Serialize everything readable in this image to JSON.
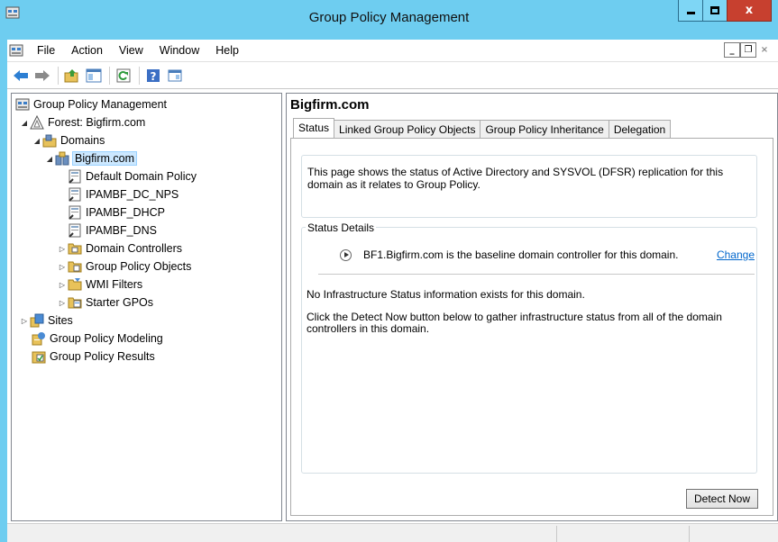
{
  "window": {
    "title": "Group Policy Management",
    "minimize_glyph": "",
    "maximize_glyph": "",
    "close_glyph": "x"
  },
  "menu": {
    "items": [
      "File",
      "Action",
      "View",
      "Window",
      "Help"
    ],
    "mdi_minimize": "_",
    "mdi_restore": "❐",
    "mdi_close": "×"
  },
  "toolbar": {
    "icons": [
      "back-arrow-icon",
      "forward-arrow-icon",
      "up-folder-icon",
      "show-hide-console-tree-icon",
      "refresh-icon",
      "help-icon",
      "properties-icon"
    ]
  },
  "tree": {
    "root": "Group Policy Management",
    "forest": "Forest: Bigfirm.com",
    "domains": "Domains",
    "domain": "Bigfirm.com",
    "gpo_links": [
      "Default Domain Policy",
      "IPAMBF_DC_NPS",
      "IPAMBF_DHCP",
      "IPAMBF_DNS"
    ],
    "containers": [
      "Domain Controllers",
      "Group Policy Objects",
      "WMI Filters",
      "Starter GPOs"
    ],
    "sites": "Sites",
    "modeling": "Group Policy Modeling",
    "results": "Group Policy Results",
    "expanded_glyph": "◢",
    "collapsed_glyph": "▷"
  },
  "content": {
    "title": "Bigfirm.com",
    "tabs": [
      "Status",
      "Linked Group Policy Objects",
      "Group Policy Inheritance",
      "Delegation"
    ],
    "active_tab": "Status",
    "info_text": "This page shows the status of Active Directory and SYSVOL (DFSR) replication for this domain as it relates to Group Policy.",
    "group_title": "Status Details",
    "baseline_text": "BF1.Bigfirm.com is the baseline domain controller for this domain.",
    "change_link": "Change",
    "no_info_text": "No Infrastructure Status information exists for this domain.",
    "detect_instructions": "Click the Detect Now button below to gather infrastructure status from all of the domain controllers in this domain.",
    "detect_button": "Detect Now"
  },
  "colors": {
    "titlebar": "#6ecdf0",
    "close_button": "#c7402f",
    "link": "#0066cc",
    "selection": "#cce8ff"
  }
}
